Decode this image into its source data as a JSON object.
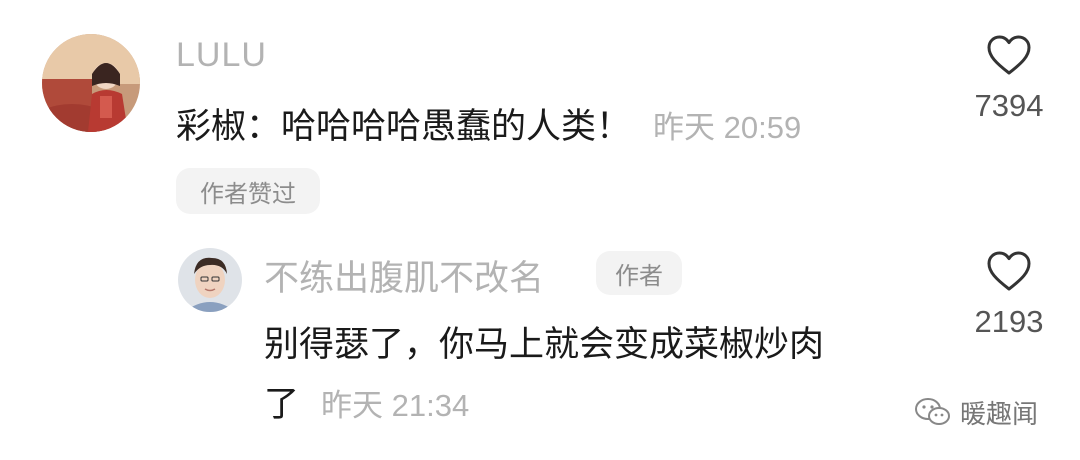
{
  "comment": {
    "username": "LULU",
    "text": "彩椒：哈哈哈哈愚蠢的人类！",
    "timestamp": "昨天 20:59",
    "badge": "作者赞过",
    "likes": "7394",
    "avatar_icon": "user-avatar-photo",
    "like_icon": "heart-outline-icon"
  },
  "reply": {
    "username": "不练出腹肌不改名",
    "author_tag": "作者",
    "text_line1": "别得瑟了，你马上就会变成菜椒炒肉",
    "text_line2": "了",
    "timestamp": "昨天 21:34",
    "likes": "2193",
    "avatar_icon": "user-avatar-photo",
    "like_icon": "heart-outline-icon"
  },
  "watermark": {
    "text": "暖趣闻",
    "icon": "wechat-icon"
  },
  "colors": {
    "username": "#b3b3b3",
    "text": "#1a1a1a",
    "chip_bg": "#f3f3f3",
    "chip_text": "#8c8c8c",
    "count": "#555555"
  }
}
